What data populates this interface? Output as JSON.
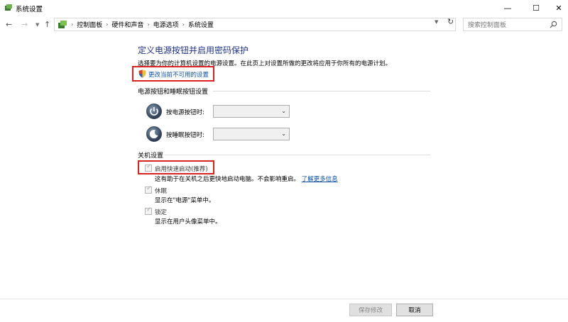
{
  "window": {
    "title": "系统设置",
    "controls": {
      "minimize": "—",
      "maximize": "☐",
      "close": "✕"
    }
  },
  "nav": {
    "back": "←",
    "forward": "→",
    "up": "↑",
    "breadcrumbs": [
      "控制面板",
      "硬件和声音",
      "电源选项",
      "系统设置"
    ],
    "search_placeholder": "搜索控制面板",
    "refresh": "↻"
  },
  "page": {
    "heading": "定义电源按钮并启用密码保护",
    "description": "选择要为你的计算机设置的电源设置。在此页上对设置所做的更改将应用于你所有的电源计划。",
    "change_link": "更改当前不可用的设置"
  },
  "power_buttons": {
    "section_title": "电源按钮和睡眠按钮设置",
    "power_label": "按电源按钮时:",
    "power_value": "",
    "sleep_label": "按睡眠按钮时:",
    "sleep_value": ""
  },
  "shutdown": {
    "section_title": "关机设置",
    "fast_startup": {
      "label": "启用快速启动(推荐)",
      "checked": true,
      "desc": "这有助于在关机之后更快地启动电脑。不会影响重启。",
      "learn_more": "了解更多信息"
    },
    "hibernate": {
      "label": "休眠",
      "checked": true,
      "desc": "显示在\"电源\"菜单中。"
    },
    "lock": {
      "label": "锁定",
      "checked": true,
      "desc": "显示在用户头像菜单中。"
    }
  },
  "footer": {
    "save": "保存修改",
    "cancel": "取消"
  },
  "colors": {
    "heading": "#1e3287",
    "link": "#0a4fa8",
    "highlight": "#d9231e"
  }
}
